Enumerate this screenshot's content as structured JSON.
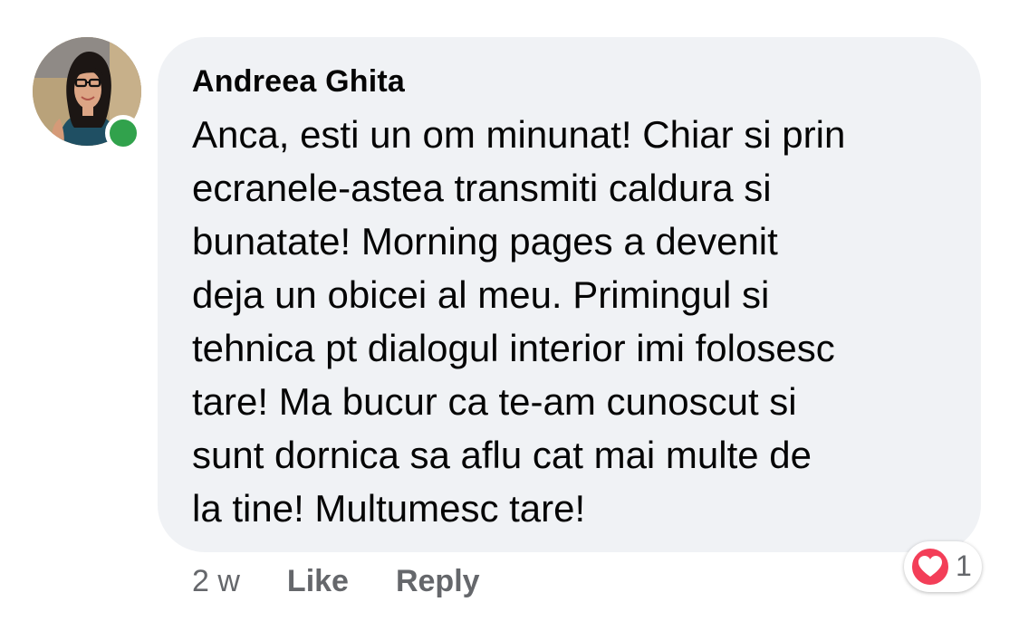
{
  "comment": {
    "author": "Andreea Ghita",
    "text_lines": [
      "Anca, esti un om minunat! Chiar si prin",
      "ecranele-astea transmiti caldura si",
      "bunatate! Morning pages a devenit",
      "deja un obicei al meu. Primingul si",
      "tehnica pt dialogul interior imi folosesc",
      "tare! Ma bucur ca te-am cunoscut si",
      "sunt dornica sa aflu cat mai multe de",
      "la tine! Multumesc tare!"
    ],
    "online": true
  },
  "actions": {
    "time": "2 w",
    "like_label": "Like",
    "reply_label": "Reply"
  },
  "reaction": {
    "icon": "heart-icon",
    "count": "1"
  },
  "colors": {
    "bubble_bg": "#f0f2f5",
    "online_dot": "#31a24c",
    "heart_red": "#f33e58",
    "meta_text": "#65676b"
  }
}
